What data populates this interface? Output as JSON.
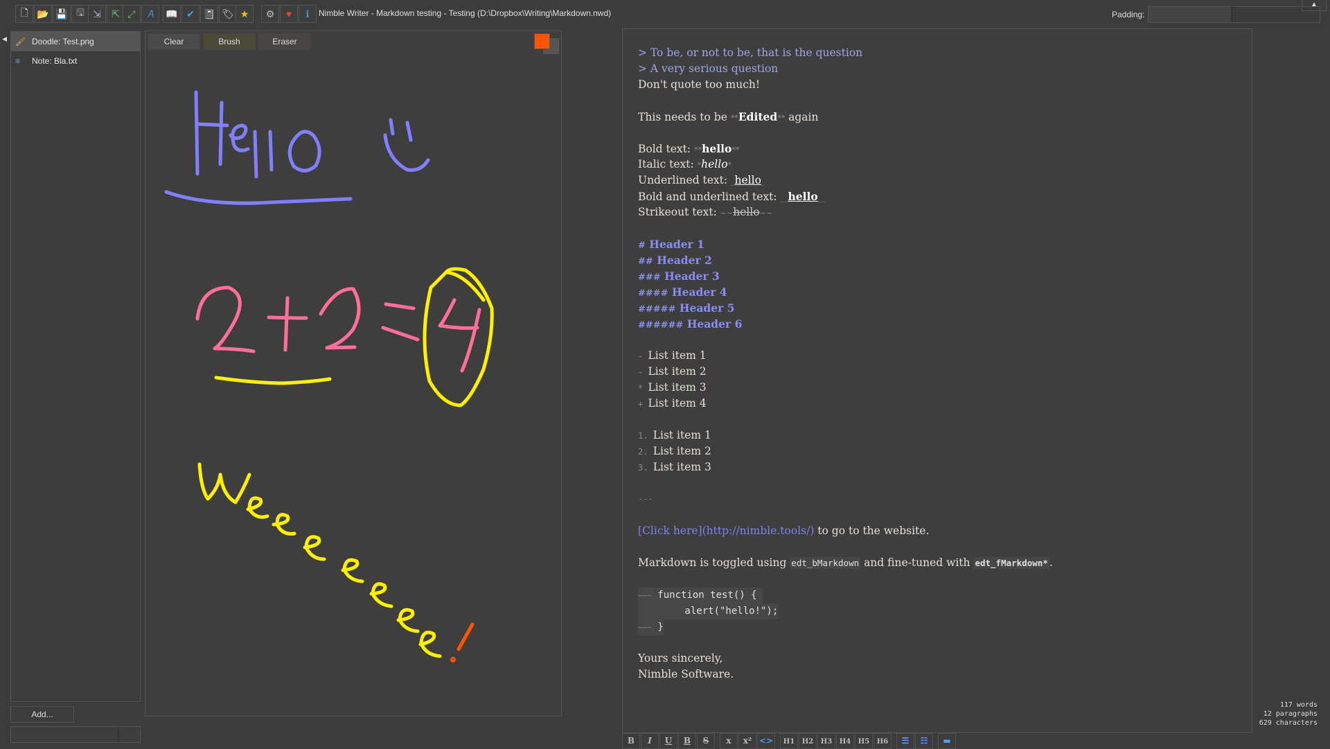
{
  "window": {
    "title": "Nimble Writer - Markdown testing - Testing (D:\\Dropbox\\Writing\\Markdown.nwd)",
    "padding_label": "Padding:",
    "collapse_icon": "chevron-up-icon"
  },
  "toolbar": {
    "groups": [
      [
        {
          "icon": "new-file-icon",
          "glyph": "🗋"
        },
        {
          "icon": "open-folder-icon",
          "glyph": "📂"
        },
        {
          "icon": "save-icon",
          "glyph": "💾"
        },
        {
          "icon": "save-all-icon",
          "glyph": "🖫"
        }
      ],
      [
        {
          "icon": "import-icon",
          "glyph": "⇲"
        },
        {
          "icon": "export-icon",
          "glyph": "⇱"
        }
      ],
      [
        {
          "icon": "fullscreen-icon",
          "glyph": "⤢"
        },
        {
          "icon": "font-icon",
          "glyph": "𝐴"
        }
      ],
      [
        {
          "icon": "book-icon",
          "glyph": "📖"
        },
        {
          "icon": "spellcheck-icon",
          "glyph": "✔"
        },
        {
          "icon": "notebook-icon",
          "glyph": "📓"
        },
        {
          "icon": "tag-icon",
          "glyph": "🏷"
        }
      ],
      [
        {
          "icon": "star-icon",
          "glyph": "★"
        }
      ],
      [
        {
          "icon": "gear-icon",
          "glyph": "⚙"
        },
        {
          "icon": "heart-icon",
          "glyph": "♥"
        },
        {
          "icon": "info-icon",
          "glyph": "ℹ"
        }
      ]
    ]
  },
  "sidebar": {
    "items": [
      {
        "label": "Doodle: Test.png",
        "icon": "brush-icon",
        "glyph": "🖌",
        "active": true
      },
      {
        "label": "Note: Bla.txt",
        "icon": "note-icon",
        "glyph": "≡",
        "active": false
      }
    ],
    "add_label": "Add..."
  },
  "doodle": {
    "tools": [
      "Clear",
      "Brush",
      "Eraser"
    ],
    "active_tool": "Brush",
    "foreground_color": "#ff5500",
    "background_color": "#555555",
    "strokes_colors": {
      "blue": "#8080ff",
      "pink": "#ff6f9a",
      "yellow": "#ffef00",
      "orange": "#ff5500"
    }
  },
  "editor": {
    "quote1_mark": "> ",
    "quote1": "To be, or not to be, that is the question",
    "quote2_mark": "> ",
    "quote2": "A very serious question",
    "line3": "Don't quote too much!",
    "edited_pre": "This needs to be ",
    "edited_bold": "Edited",
    "edited_post": " again",
    "bold_label": "Bold text: ",
    "italic_label": "Italic text: ",
    "underline_label": "Underlined text: ",
    "boldunder_label": "Bold and underlined text: ",
    "strike_label": "Strikeout text: ",
    "hello": "hello",
    "mk_bold": "**",
    "mk_italic": "*",
    "mk_under": "_",
    "mk_boldunder": "__",
    "mk_strike": "~~",
    "headers": [
      {
        "marks": "#",
        "text": " Header 1"
      },
      {
        "marks": "##",
        "text": " Header 2"
      },
      {
        "marks": "###",
        "text": " Header 3"
      },
      {
        "marks": "####",
        "text": " Header 4"
      },
      {
        "marks": "#####",
        "text": " Header 5"
      },
      {
        "marks": "######",
        "text": " Header 6"
      }
    ],
    "bullets": [
      {
        "mark": "- ",
        "text": "List item 1"
      },
      {
        "mark": "- ",
        "text": "List item 2"
      },
      {
        "mark": "* ",
        "text": "List item 3"
      },
      {
        "mark": "+ ",
        "text": "List item 4"
      }
    ],
    "numbered": [
      {
        "mark": "1. ",
        "text": "List item 1"
      },
      {
        "mark": "2. ",
        "text": "List item 2"
      },
      {
        "mark": "3. ",
        "text": "List item 3"
      }
    ],
    "hr": "---",
    "link_text": "[Click here](http://nimble.tools/)",
    "link_after": " to go to the website.",
    "md_pre": "Markdown is toggled using ",
    "md_code1": "edt_bMarkdown",
    "md_mid": " and fine-tuned with ",
    "md_code2": "edt_fMarkdown*",
    "md_post": ".",
    "fence_mark": "~~~",
    "code_line1": " function test() {",
    "code_line2": "        alert(\"hello!\");",
    "code_line3": " }",
    "sign1": "Yours sincerely,",
    "sign2": "Nimble Software."
  },
  "stats": {
    "words": "117 words",
    "paragraphs": "12 paragraphs",
    "characters": "629 characters"
  },
  "format_bar": {
    "groups": [
      [
        {
          "icon": "bold-icon",
          "label": "B"
        },
        {
          "icon": "italic-icon",
          "label": "I"
        },
        {
          "icon": "underline-icon",
          "label": "U"
        },
        {
          "icon": "bold-underline-icon",
          "label": "B"
        },
        {
          "icon": "strikethrough-icon",
          "label": "S"
        }
      ],
      [
        {
          "icon": "subscript-icon",
          "label": "x"
        },
        {
          "icon": "superscript-icon",
          "label": "x²"
        },
        {
          "icon": "code-icon",
          "label": "<>"
        }
      ],
      [
        {
          "icon": "h1-icon",
          "label": "H1"
        },
        {
          "icon": "h2-icon",
          "label": "H2"
        },
        {
          "icon": "h3-icon",
          "label": "H3"
        },
        {
          "icon": "h4-icon",
          "label": "H4"
        },
        {
          "icon": "h5-icon",
          "label": "H5"
        },
        {
          "icon": "h6-icon",
          "label": "H6"
        }
      ],
      [
        {
          "icon": "bullet-list-icon",
          "label": "☰"
        },
        {
          "icon": "numbered-list-icon",
          "label": "☷"
        }
      ],
      [
        {
          "icon": "horizontal-rule-icon",
          "label": "▬"
        }
      ]
    ]
  }
}
